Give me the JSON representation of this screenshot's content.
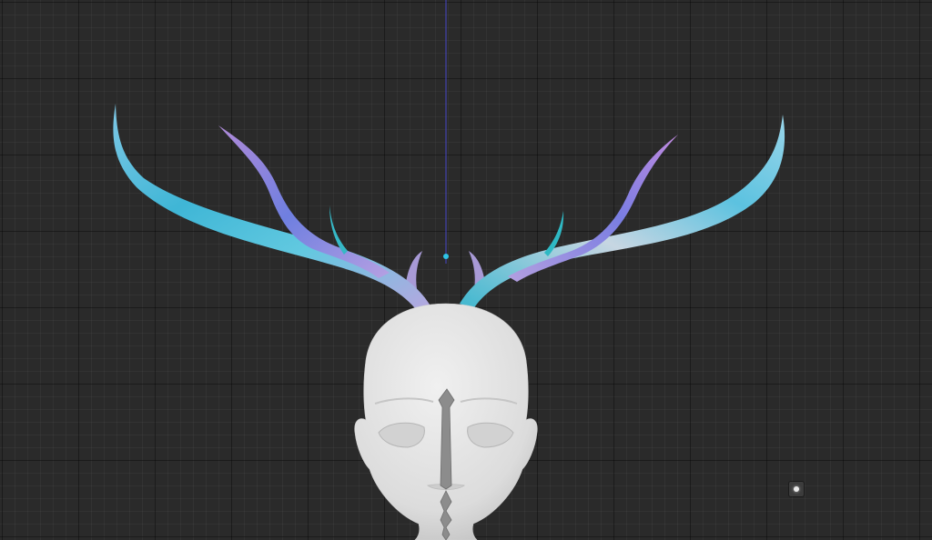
{
  "app": {
    "view": "3d-viewport",
    "background_color": "#2a2a2a",
    "grid_color": "#1c1c1c",
    "axis_line_color": "#4a4acb",
    "pivot_color": "#2ec4e6"
  },
  "scene": {
    "objects": [
      {
        "name": "head-mesh",
        "color": "#e2e2e2"
      },
      {
        "name": "antlers",
        "colors": [
          "#3fb0d0",
          "#6fd6d0",
          "#8a8ee0",
          "#b89ad8",
          "#d7cbe0"
        ]
      },
      {
        "name": "face-seam",
        "color": "#8a8a8a"
      }
    ]
  },
  "gizmos": {
    "light": {
      "icon": "light-icon",
      "color": "#e9e9e9"
    }
  }
}
